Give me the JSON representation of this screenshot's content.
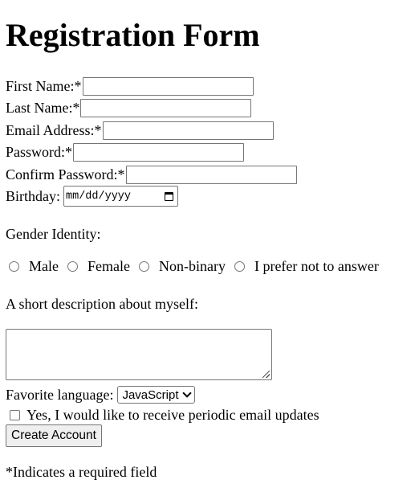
{
  "title": "Registration Form",
  "fields": {
    "first_name_label": "First Name:*",
    "last_name_label": "Last Name:*",
    "email_label": "Email Address:*",
    "password_label": "Password:*",
    "confirm_password_label": "Confirm Password:*",
    "birthday_label": "Birthday:",
    "birthday_placeholder": "mm/dd/yyyy"
  },
  "gender": {
    "label": "Gender Identity:",
    "options": [
      "Male",
      "Female",
      "Non-binary",
      "I prefer not to answer"
    ]
  },
  "description": {
    "label": "A short description about myself:"
  },
  "language": {
    "label": "Favorite language:",
    "selected": "JavaScript"
  },
  "updates": {
    "label": "Yes, I would like to receive periodic email updates"
  },
  "submit_label": "Create Account",
  "footnote": "*Indicates a required field"
}
